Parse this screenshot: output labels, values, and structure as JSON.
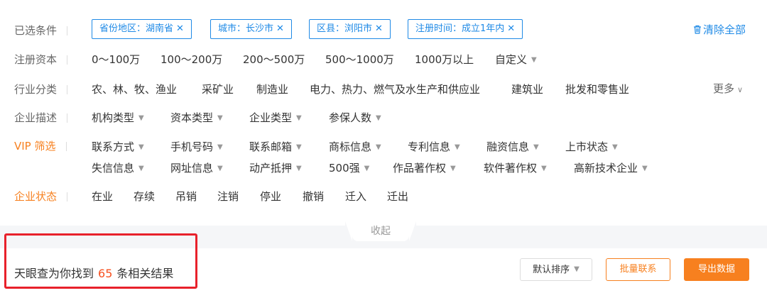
{
  "filters": {
    "selected_label": "已选条件",
    "tags": [
      {
        "text": "省份地区：湖南省"
      },
      {
        "text": "城市：长沙市"
      },
      {
        "text": "区县：浏阳市"
      },
      {
        "text": "注册时间：成立1年内"
      }
    ],
    "clear_all": "清除全部",
    "capital": {
      "label": "注册资本",
      "options": [
        "0～100万",
        "100～200万",
        "200～500万",
        "500～1000万",
        "1000万以上",
        "自定义"
      ]
    },
    "industry": {
      "label": "行业分类",
      "options": [
        "农、林、牧、渔业",
        "采矿业",
        "制造业",
        "电力、热力、燃气及水生产和供应业",
        "建筑业",
        "批发和零售业"
      ],
      "more": "更多"
    },
    "description": {
      "label": "企业描述",
      "options": [
        "机构类型",
        "资本类型",
        "企业类型",
        "参保人数"
      ]
    },
    "vip": {
      "label": "VIP 筛选",
      "row1": [
        "联系方式",
        "手机号码",
        "联系邮箱",
        "商标信息",
        "专利信息",
        "融资信息",
        "上市状态"
      ],
      "row2": [
        "失信信息",
        "网址信息",
        "动产抵押",
        "500强",
        "作品著作权",
        "软件著作权",
        "高新技术企业"
      ]
    },
    "status": {
      "label": "企业状态",
      "options": [
        "在业",
        "存续",
        "吊销",
        "注销",
        "停业",
        "撤销",
        "迁入",
        "迁出"
      ]
    },
    "collapse": "收起"
  },
  "results": {
    "prefix": "天眼查为你找到",
    "count": "65",
    "suffix": "条相关结果"
  },
  "toolbar": {
    "sort": "默认排序",
    "bulk_contact": "批量联系",
    "export": "导出数据"
  },
  "colors": {
    "accent_blue": "#1f8ae6",
    "accent_orange": "#f7801f",
    "highlight_red": "#e8212b"
  }
}
